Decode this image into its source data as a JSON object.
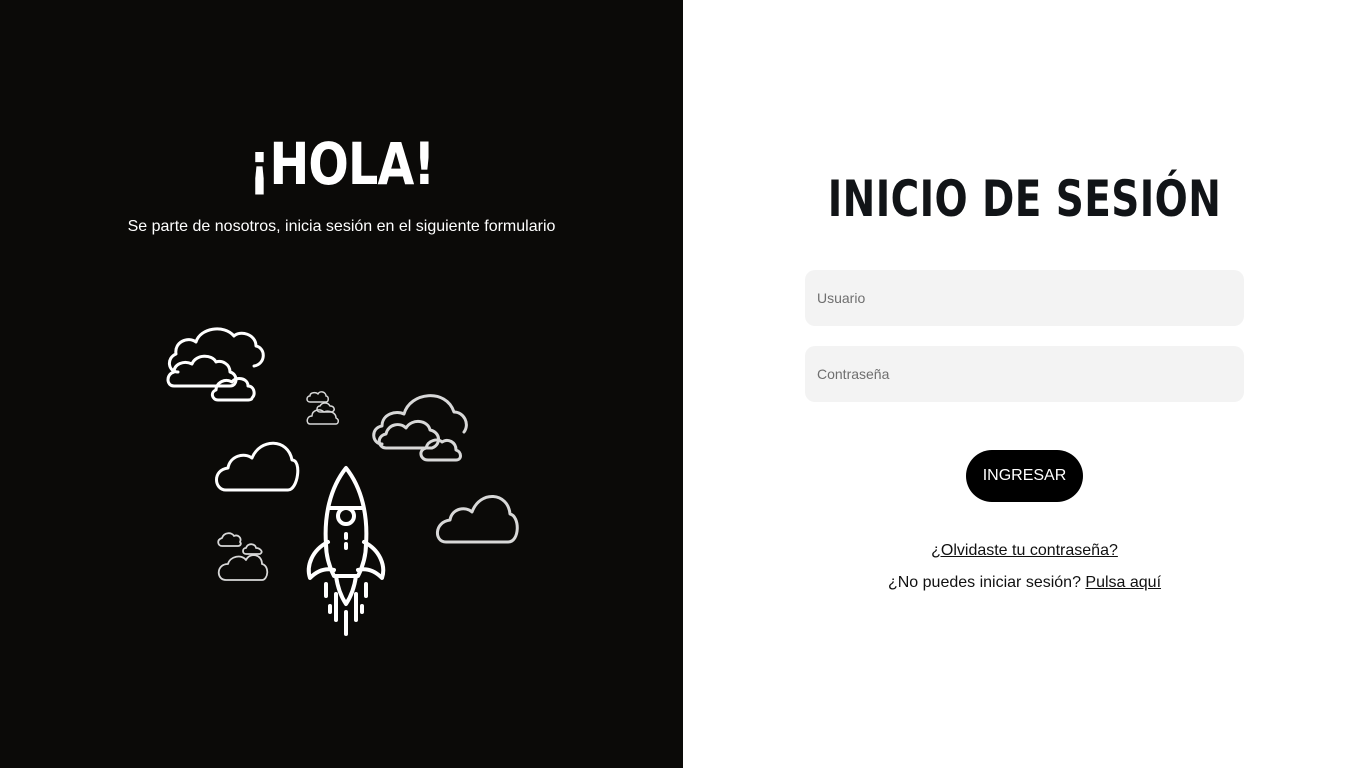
{
  "welcome": {
    "title": "¡HOLA!",
    "subtitle": "Se parte de nosotros, inicia sesión en el siguiente formulario"
  },
  "illustration": {
    "icons": [
      "cloud-icon",
      "rocket-icon"
    ],
    "stroke_color": "#ffffff",
    "background_color": "#0b0a08"
  },
  "login": {
    "title": "INICIO DE SESIÓN",
    "username_placeholder": "Usuario",
    "password_placeholder": "Contraseña",
    "submit_label": "INGRESAR",
    "forgot_link": "¿Olvidaste tu contraseña?",
    "help_text": "¿No puedes iniciar sesión?",
    "help_link": "Pulsa aquí"
  },
  "colors": {
    "left_panel": "#0b0a08",
    "right_panel": "#ffffff",
    "input_background": "#f3f3f3",
    "button_background": "#000000",
    "title_text": "#111417"
  }
}
